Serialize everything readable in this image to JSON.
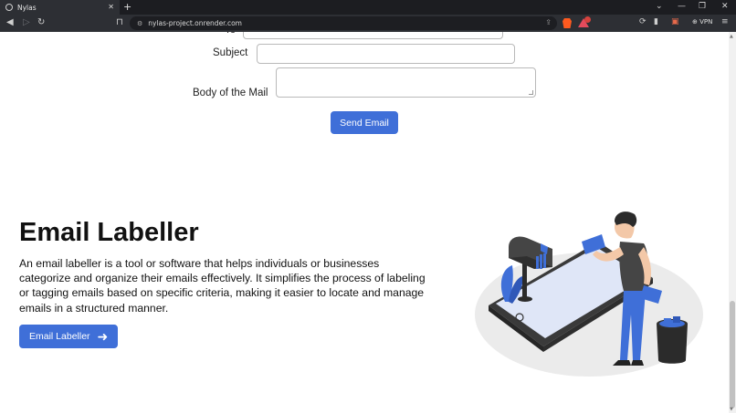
{
  "browser": {
    "tab_title": "Nylas",
    "tab_close": "✕",
    "new_tab": "+",
    "url": "nylas-project.onrender.com",
    "vpn_label": "VPN",
    "window_controls": [
      "⌄",
      "—",
      "❐",
      "✕"
    ]
  },
  "form": {
    "to_label_partial": "To",
    "subject_label": "Subject",
    "body_label": "Body of the Mail",
    "send_button": "Send Email"
  },
  "hero": {
    "title": "Email Labeller",
    "description": "An email labeller is a tool or software that helps individuals or businesses categorize and organize their emails effectively. It simplifies the process of labeling or tagging emails based on specific criteria, making it easier to locate and manage emails in a structured manner.",
    "cta_label": "Email Labeller",
    "cta_icon": "arrow-right-icon",
    "illustration": "person-sorting-mail-illustration"
  },
  "colors": {
    "accent": "#3f6fd8",
    "chrome_bg": "#2d2f34",
    "tabbar_bg": "#1c1d21",
    "text": "#111111"
  }
}
